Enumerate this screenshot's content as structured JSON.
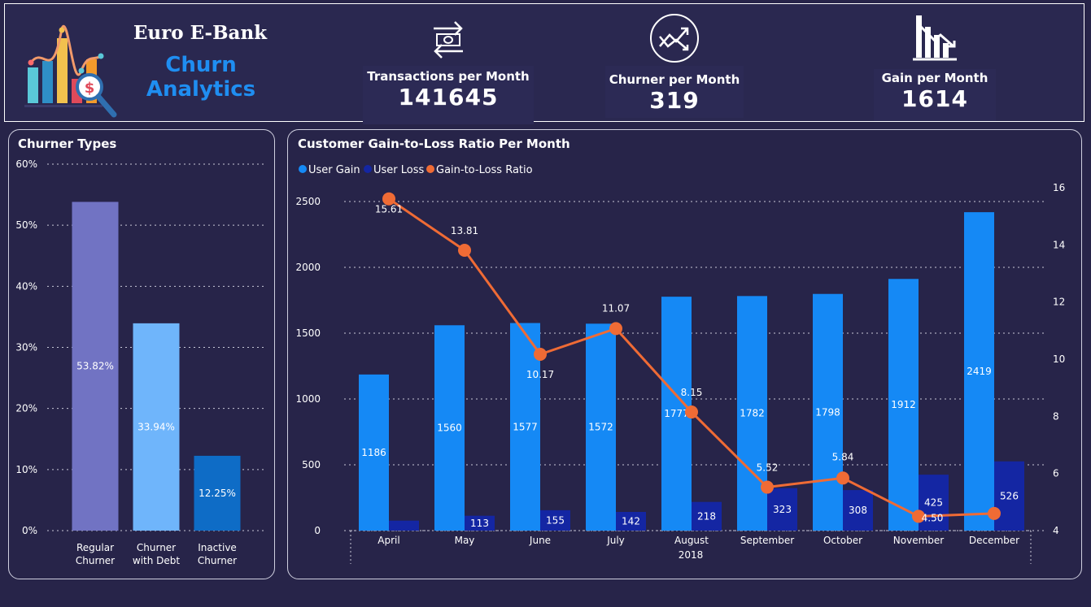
{
  "brand": {
    "title": "Euro E-Bank",
    "subtitle": "Churn Analytics"
  },
  "kpis": [
    {
      "label": "Transactions per Month",
      "value": "141645",
      "icon": "exchange-money-icon"
    },
    {
      "label": "Churner per Month",
      "value": "319",
      "icon": "trend-arrows-icon"
    },
    {
      "label": "Gain per Month",
      "value": "1614",
      "icon": "declining-bar-chart-icon"
    }
  ],
  "colors": {
    "background": "#272449",
    "brand_blue": "#1f8ef1",
    "user_gain": "#1589f5",
    "user_loss": "#1426a3",
    "ratio_line": "#ef6b35",
    "regular_churner": "#7173c3",
    "churner_with_debt": "#6fb5fb",
    "inactive_churner": "#0e6cc6"
  },
  "chart_data": [
    {
      "type": "bar",
      "title": "Churner Types",
      "categories": [
        "Regular Churner",
        "Churner with Debt",
        "Inactive Churner"
      ],
      "category_lines": [
        [
          "Regular",
          "Churner"
        ],
        [
          "Churner",
          "with Debt"
        ],
        [
          "Inactive",
          "Churner"
        ]
      ],
      "values": [
        53.82,
        33.94,
        12.25
      ],
      "data_labels": [
        "53.82%",
        "33.94%",
        "12.25%"
      ],
      "ylim": [
        0,
        60
      ],
      "yticks": [
        "0%",
        "10%",
        "20%",
        "30%",
        "40%",
        "50%",
        "60%"
      ],
      "grid": true
    },
    {
      "type": "bar",
      "title": "Customer Gain-to-Loss Ratio Per Month",
      "categories": [
        "April",
        "May",
        "June",
        "July",
        "August",
        "September",
        "October",
        "November",
        "December"
      ],
      "x_group_label": "2018",
      "series": [
        {
          "name": "User Gain",
          "type": "bar",
          "axis": "left",
          "values": [
            1186,
            1560,
            1577,
            1572,
            1777,
            1782,
            1798,
            1912,
            2419
          ]
        },
        {
          "name": "User Loss",
          "type": "bar",
          "axis": "left",
          "values": [
            76,
            113,
            155,
            142,
            218,
            323,
            308,
            425,
            526
          ]
        },
        {
          "name": "Gain-to-Loss Ratio",
          "type": "line",
          "axis": "right",
          "values": [
            15.61,
            13.81,
            10.17,
            11.07,
            8.15,
            5.52,
            5.84,
            4.5,
            4.6
          ]
        }
      ],
      "gain_labels": [
        "1186",
        "1560",
        "1577",
        "1572",
        "1777",
        "1782",
        "1798",
        "1912",
        "2419"
      ],
      "loss_labels": [
        "",
        "113",
        "155",
        "142",
        "218",
        "323",
        "308",
        "425",
        "526"
      ],
      "ratio_labels": [
        "15.61",
        "13.81",
        "10.17",
        "11.07",
        "8.15",
        "5.52",
        "5.84",
        "4.50",
        ""
      ],
      "ylim_left": [
        0,
        2500
      ],
      "yticks_left": [
        "0",
        "500",
        "1000",
        "1500",
        "2000",
        "2500"
      ],
      "ylim_right": [
        4,
        16
      ],
      "yticks_right": [
        "4",
        "6",
        "8",
        "10",
        "12",
        "14",
        "16"
      ],
      "legend_position": "top-left",
      "grid": true
    }
  ]
}
